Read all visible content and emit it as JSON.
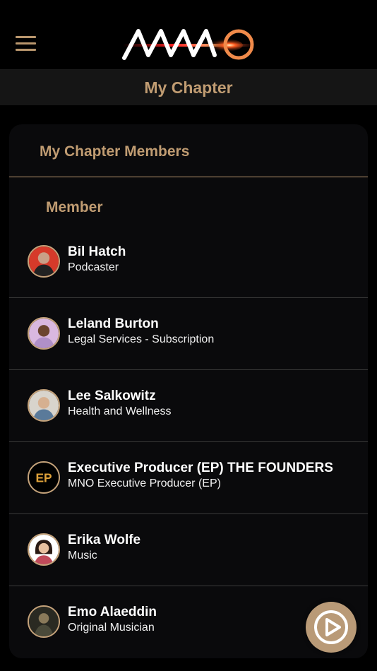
{
  "header": {
    "subtitle": "My Chapter",
    "logo_icon": "mno-logo-icon",
    "menu_icon": "hamburger-menu-icon"
  },
  "card": {
    "title": "My Chapter Members",
    "section_label": "Member"
  },
  "members": [
    {
      "name": "Bil Hatch",
      "role": "Podcaster"
    },
    {
      "name": "Leland Burton",
      "role": "Legal Services - Subscription"
    },
    {
      "name": "Lee Salkowitz",
      "role": "Health and Wellness"
    },
    {
      "name": "Executive Producer (EP) THE FOUNDERS",
      "role": "MNO Executive Producer (EP)",
      "avatar_text": "EP"
    },
    {
      "name": "Erika Wolfe",
      "role": "Music"
    },
    {
      "name": "Emo Alaeddin",
      "role": "Original Musician"
    }
  ],
  "colors": {
    "accent": "#c09c72",
    "background": "#000000",
    "card": "#0a0a0c",
    "play_button": "#b99a77"
  },
  "play_button": {
    "icon": "play-circle-icon"
  }
}
